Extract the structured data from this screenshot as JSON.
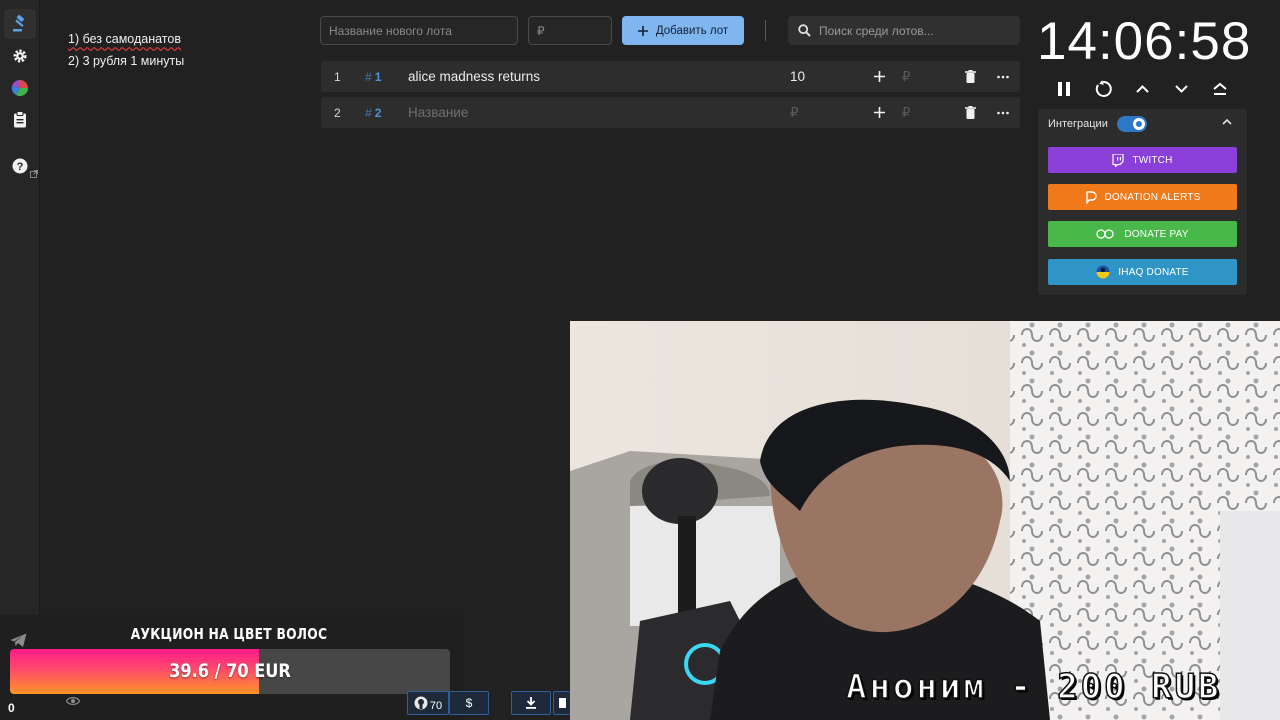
{
  "sidebar": {
    "items": [
      {
        "icon": "gavel-icon",
        "active": true
      },
      {
        "icon": "gear-icon",
        "active": false
      },
      {
        "icon": "pie-chart-icon",
        "active": false
      },
      {
        "icon": "clipboard-icon",
        "active": false
      },
      {
        "icon": "help-icon",
        "active": false
      }
    ]
  },
  "notes": {
    "line1": "1) без самоданатов",
    "line2": "2) 3 рубля 1 минуты"
  },
  "toolbar": {
    "new_lot_placeholder": "Название нового лота",
    "amount_placeholder": "₽",
    "add_lot_label": "Добавить лот",
    "search_placeholder": "Поиск среди лотов..."
  },
  "lots": [
    {
      "index": "1",
      "tag": "1",
      "name": "alice madness returns",
      "amount": "10",
      "rub": "₽"
    },
    {
      "index": "2",
      "tag": "2",
      "name_placeholder": "Название",
      "amount_placeholder": "₽",
      "rub": "₽"
    }
  ],
  "timer": {
    "value": "14:06:58"
  },
  "integrations": {
    "title": "Интеграции",
    "enabled": true,
    "buttons": [
      {
        "label": "TWITCH",
        "color": "#8b3fd9"
      },
      {
        "label": "DONATION ALERTS",
        "color": "#f07a1a"
      },
      {
        "label": "DONATE PAY",
        "color": "#49b84a"
      },
      {
        "label": "IHAQ DONATE",
        "color": "#2f94c6"
      }
    ]
  },
  "webcam": {
    "caption": "Аноним - 200 RUB"
  },
  "goal_widget": {
    "title": "АУКЦИОН НА ЦВЕТ ВОЛОС",
    "current": 39.6,
    "target": 70,
    "currency": "EUR",
    "progress_text": "39.6 / 70 EUR",
    "progress_fraction": 0.566
  },
  "bottom": {
    "counter": "0",
    "github_count": "70",
    "dollar": "$"
  },
  "colors": {
    "accent": "#7fb6f0",
    "background": "#212121",
    "tag_blue": "#4f92d8"
  }
}
